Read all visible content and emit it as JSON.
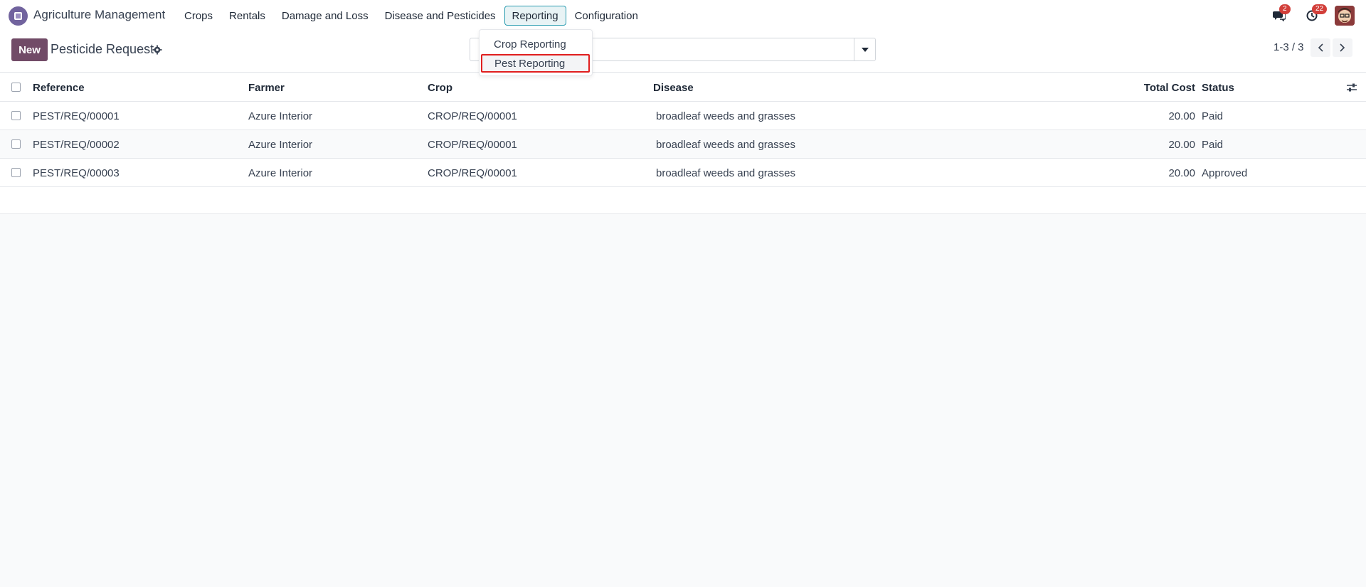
{
  "navbar": {
    "app_name": "Agriculture Management",
    "menu": [
      {
        "label": "Crops"
      },
      {
        "label": "Rentals"
      },
      {
        "label": "Damage and Loss"
      },
      {
        "label": "Disease and Pesticides"
      },
      {
        "label": "Reporting"
      },
      {
        "label": "Configuration"
      }
    ],
    "messages_badge": "2",
    "activities_badge": "22"
  },
  "control_panel": {
    "new_label": "New",
    "title": "Pesticide Request",
    "search_value": "",
    "pager": "1-3 / 3"
  },
  "dropdown": {
    "items": [
      {
        "label": "Crop Reporting"
      },
      {
        "label": "Pest Reporting"
      }
    ]
  },
  "table": {
    "headers": {
      "reference": "Reference",
      "farmer": "Farmer",
      "crop": "Crop",
      "disease": "Disease",
      "total_cost": "Total Cost",
      "status": "Status"
    },
    "rows": [
      {
        "reference": "PEST/REQ/00001",
        "farmer": "Azure Interior",
        "crop": "CROP/REQ/00001",
        "disease": "broadleaf weeds and grasses",
        "total_cost": "20.00",
        "status": "Paid"
      },
      {
        "reference": "PEST/REQ/00002",
        "farmer": "Azure Interior",
        "crop": "CROP/REQ/00001",
        "disease": "broadleaf weeds and grasses",
        "total_cost": "20.00",
        "status": "Paid"
      },
      {
        "reference": "PEST/REQ/00003",
        "farmer": "Azure Interior",
        "crop": "CROP/REQ/00001",
        "disease": "broadleaf weeds and grasses",
        "total_cost": "20.00",
        "status": "Approved"
      }
    ]
  },
  "colors": {
    "primary": "#714b67",
    "highlight_border": "#e01e1e",
    "active_menu_border": "#2b9cb0",
    "badge": "#d23f3a"
  }
}
